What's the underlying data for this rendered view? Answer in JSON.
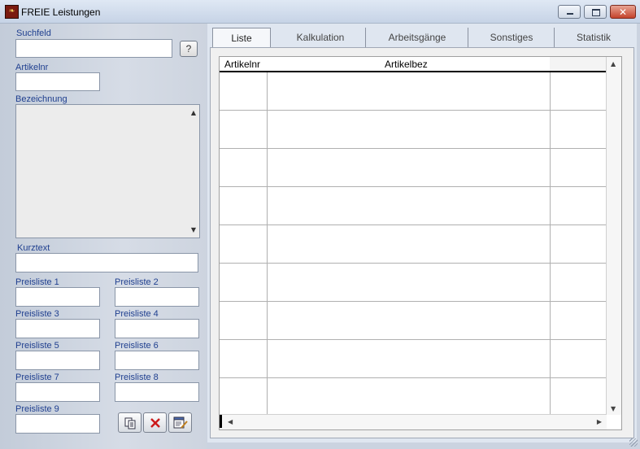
{
  "window": {
    "title": "FREIE Leistungen",
    "app_icon": "app-logo-icon",
    "controls": {
      "minimize": "minimize-icon",
      "maximize": "maximize-icon",
      "close": "close-icon"
    }
  },
  "form": {
    "suchfeld_label": "Suchfeld",
    "suchfeld_value": "",
    "help_button": "?",
    "artikelnr_label": "Artikelnr",
    "artikelnr_value": "",
    "bezeichnung_label": "Bezeichnung",
    "bezeichnung_value": "",
    "kurztext_label": "Kurztext",
    "kurztext_value": "",
    "preislisten": [
      {
        "label": "Preisliste 1",
        "value": ""
      },
      {
        "label": "Preisliste 2",
        "value": ""
      },
      {
        "label": "Preisliste 3",
        "value": ""
      },
      {
        "label": "Preisliste 4",
        "value": ""
      },
      {
        "label": "Preisliste 5",
        "value": ""
      },
      {
        "label": "Preisliste 6",
        "value": ""
      },
      {
        "label": "Preisliste 7",
        "value": ""
      },
      {
        "label": "Preisliste 8",
        "value": ""
      },
      {
        "label": "Preisliste 9",
        "value": ""
      }
    ],
    "toolbar": {
      "copy": "copy-icon",
      "delete": "delete-icon",
      "edit": "edit-icon"
    }
  },
  "tabs": [
    {
      "label": "Liste",
      "active": true
    },
    {
      "label": "Kalkulation",
      "active": false
    },
    {
      "label": "Arbeitsgänge",
      "active": false
    },
    {
      "label": "Sonstiges",
      "active": false
    },
    {
      "label": "Statistik",
      "active": false
    }
  ],
  "grid": {
    "columns": [
      "Artikelnr",
      "Artikelbez",
      ""
    ],
    "rows": [
      [],
      [],
      [],
      [],
      [],
      [],
      [],
      [],
      []
    ]
  },
  "colors": {
    "label_blue": "#1f3f8f",
    "close_red": "#c4432c",
    "delete_red": "#cc1a1a"
  }
}
